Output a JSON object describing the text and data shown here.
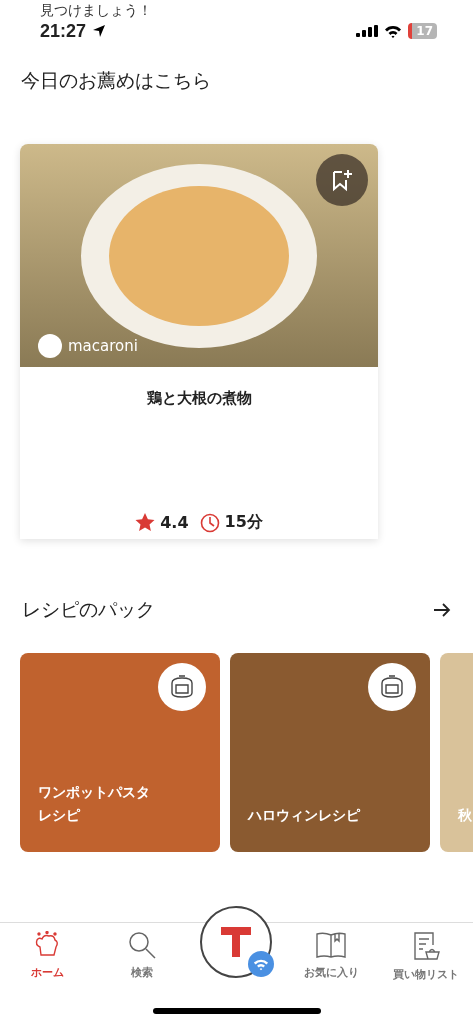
{
  "header_text": "見つけましょう！",
  "status_bar": {
    "time": "21:27",
    "battery": "17"
  },
  "recommend": {
    "heading": "今日のお薦めはこちら",
    "source": "macaroni",
    "title": "鶏と大根の煮物",
    "rating": "4.4",
    "time": "15分"
  },
  "packs": {
    "heading": "レシピのパック",
    "items": [
      {
        "title": "ワンポットパスタレシピ",
        "cooker_badge": true,
        "color": "#c0622e"
      },
      {
        "title": "ハロウィンレシピ",
        "cooker_badge": true,
        "color": "#8a5a30"
      },
      {
        "title": "秋",
        "color": "#d9c29a"
      }
    ]
  },
  "tabs": [
    {
      "label": "ホーム",
      "kind": "home",
      "selected": true
    },
    {
      "label": "検索",
      "kind": "search",
      "selected": false
    },
    {
      "label": "お気に入り",
      "kind": "book",
      "selected": false
    },
    {
      "label": "買い物リスト",
      "kind": "list",
      "selected": false
    }
  ]
}
